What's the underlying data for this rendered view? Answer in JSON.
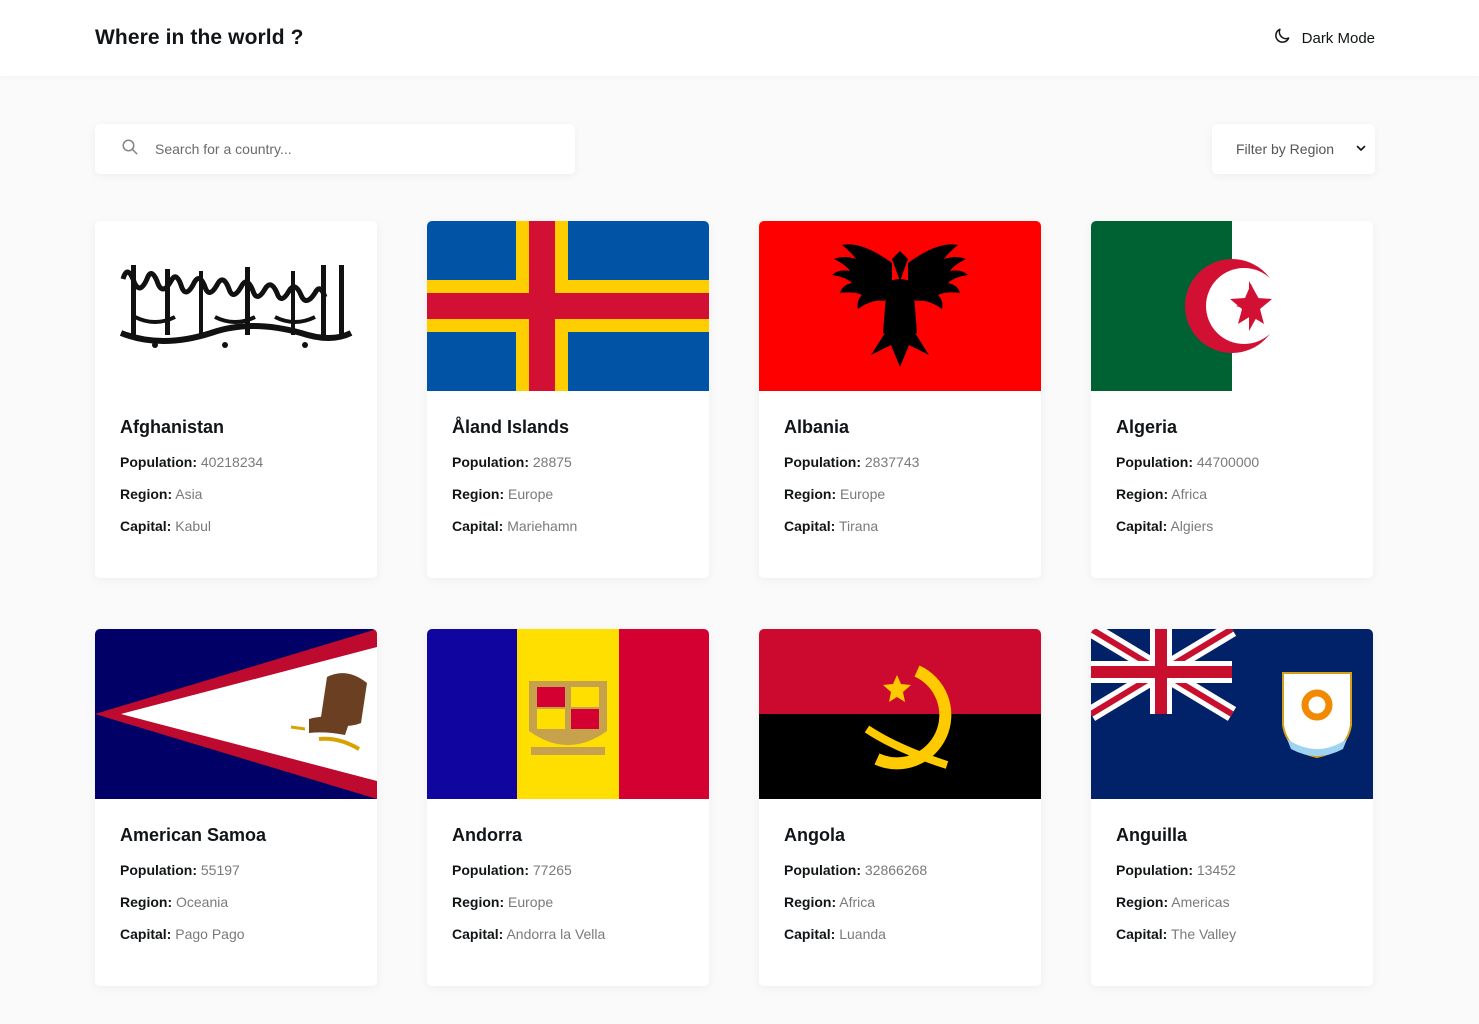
{
  "header": {
    "title": "Where in the world ?",
    "mode_label": "Dark Mode"
  },
  "search": {
    "placeholder": "Search for a country..."
  },
  "filter": {
    "label": "Filter by Region"
  },
  "labels": {
    "population": "Population:",
    "region": "Region:",
    "capital": "Capital:"
  },
  "countries": [
    {
      "name": "Afghanistan",
      "population": "40218234",
      "region": "Asia",
      "capital": "Kabul"
    },
    {
      "name": "Åland Islands",
      "population": "28875",
      "region": "Europe",
      "capital": "Mariehamn"
    },
    {
      "name": "Albania",
      "population": "2837743",
      "region": "Europe",
      "capital": "Tirana"
    },
    {
      "name": "Algeria",
      "population": "44700000",
      "region": "Africa",
      "capital": "Algiers"
    },
    {
      "name": "American Samoa",
      "population": "55197",
      "region": "Oceania",
      "capital": "Pago Pago"
    },
    {
      "name": "Andorra",
      "population": "77265",
      "region": "Europe",
      "capital": "Andorra la Vella"
    },
    {
      "name": "Angola",
      "population": "32866268",
      "region": "Africa",
      "capital": "Luanda"
    },
    {
      "name": "Anguilla",
      "population": "13452",
      "region": "Americas",
      "capital": "The Valley"
    }
  ],
  "colors": {
    "background": "#fafafa",
    "element": "#ffffff",
    "text": "#111517",
    "muted": "#7a7a7a"
  },
  "icons": {
    "mode": "moon-icon",
    "search": "search-icon",
    "filter": "chevron-down-icon"
  }
}
